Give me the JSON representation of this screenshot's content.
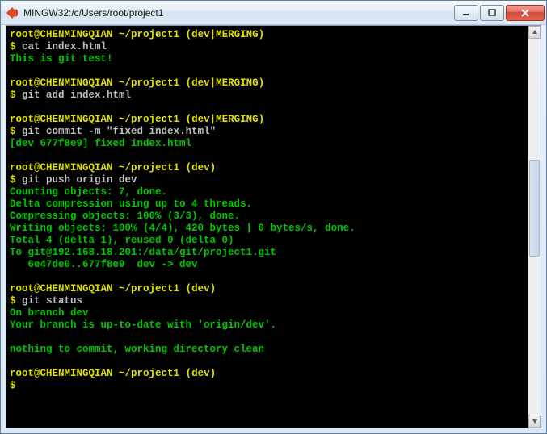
{
  "window": {
    "title": "MINGW32:/c/Users/root/project1"
  },
  "prompt": {
    "user_host": "root@CHENMINGQIAN",
    "path": "~/project1",
    "branch_merging": "(dev|MERGING)",
    "branch_dev": "(dev)",
    "dollar": "$"
  },
  "lines": {
    "cmd_cat": "cat index.html",
    "out_cat": "This is git test!",
    "cmd_add": "git add index.html",
    "cmd_commit": "git commit -m \"fixed index.html\"",
    "out_commit": "[dev 677f8e9] fixed index.html",
    "cmd_push": "git push origin dev",
    "out_push1": "Counting objects: 7, done.",
    "out_push2": "Delta compression using up to 4 threads.",
    "out_push3": "Compressing objects: 100% (3/3), done.",
    "out_push4": "Writing objects: 100% (4/4), 420 bytes | 0 bytes/s, done.",
    "out_push5": "Total 4 (delta 1), reused 0 (delta 0)",
    "out_push6": "To git@192.168.18.201:/data/git/project1.git",
    "out_push7": "   6e47de0..677f8e9  dev -> dev",
    "cmd_status": "git status",
    "out_status1": "On branch dev",
    "out_status2": "Your branch is up-to-date with 'origin/dev'.",
    "out_status3": "nothing to commit, working directory clean"
  }
}
